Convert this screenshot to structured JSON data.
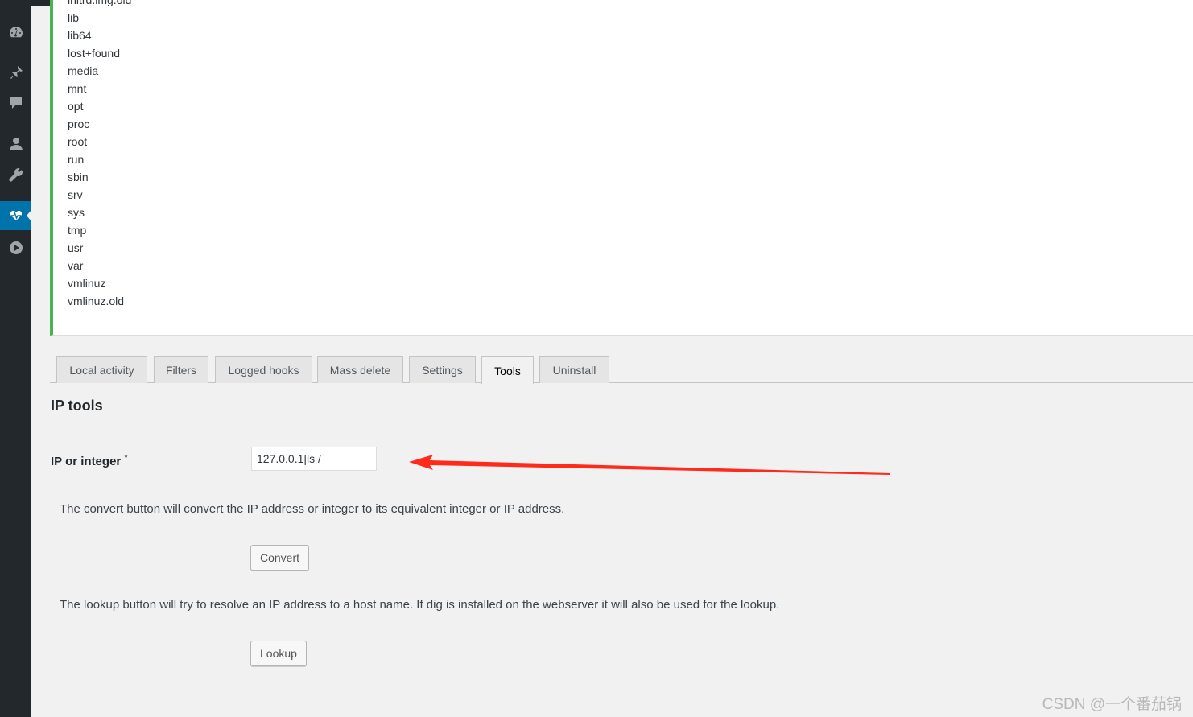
{
  "sidebar": {
    "items": [
      {
        "icon": "dashboard-icon",
        "active": false
      },
      {
        "icon": "pin-icon",
        "active": false
      },
      {
        "icon": "comment-icon",
        "active": false
      },
      {
        "icon": "user-icon",
        "active": false
      },
      {
        "icon": "wrench-icon",
        "active": false
      },
      {
        "icon": "heartbeat-icon",
        "active": true
      },
      {
        "icon": "play-icon",
        "active": false
      }
    ],
    "active_color": "#0073aa"
  },
  "output": {
    "lines": [
      "initrd.img.old",
      "lib",
      "lib64",
      "lost+found",
      "media",
      "mnt",
      "opt",
      "proc",
      "root",
      "run",
      "sbin",
      "srv",
      "sys",
      "tmp",
      "usr",
      "var",
      "vmlinuz",
      "vmlinuz.old"
    ],
    "accent_color": "#46b450"
  },
  "tabs": [
    {
      "label": "Local activity",
      "active": false
    },
    {
      "label": "Filters",
      "active": false
    },
    {
      "label": "Logged hooks",
      "active": false
    },
    {
      "label": "Mass delete",
      "active": false
    },
    {
      "label": "Settings",
      "active": false
    },
    {
      "label": "Tools",
      "active": true
    },
    {
      "label": "Uninstall",
      "active": false
    }
  ],
  "tools": {
    "heading": "IP tools",
    "field_label": "IP or integer",
    "required_mark": "*",
    "ip_value": "127.0.0.1|ls /",
    "convert_help": "The convert button will convert the IP address or integer to its equivalent integer or IP address.",
    "convert_label": "Convert",
    "lookup_help": "The lookup button will try to resolve an IP address to a host name. If dig is installed on the webserver it will also be used for the lookup.",
    "lookup_label": "Lookup"
  },
  "annotation": {
    "arrow_color": "#ff2a1a"
  },
  "watermark": "CSDN @一个番茄锅"
}
